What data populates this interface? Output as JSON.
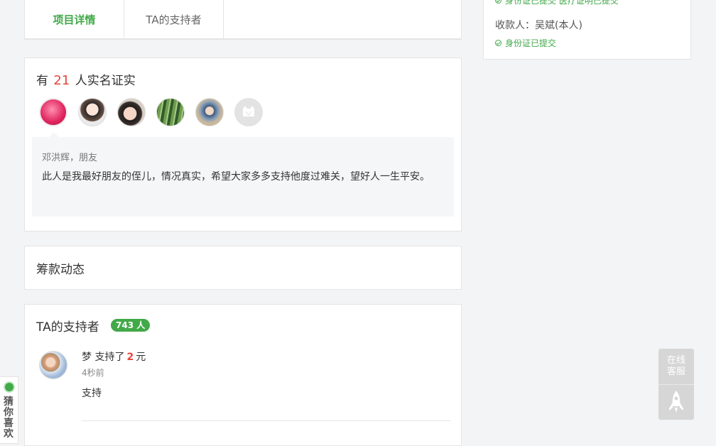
{
  "tabs": [
    {
      "label": "项目详情",
      "active": true
    },
    {
      "label": "TA的支持者",
      "active": false
    }
  ],
  "sidebar": {
    "payee_label": "收款人：",
    "payee_name": "吴斌(本人)",
    "id_status": "身份证已提交",
    "top_partial": "身份证已提交  医疗证明已提交"
  },
  "verify": {
    "title_prefix": "有",
    "count": "21",
    "title_suffix": "人实名证实",
    "avatars": [
      "avatar-flower",
      "avatar-girl",
      "avatar-child",
      "avatar-plants",
      "avatar-boy",
      "avatar-default"
    ],
    "quote": {
      "author": "邓洪辉，朋友",
      "text": "此人是我最好朋友的侄儿，情况真实，希望大家多多支持他度过难关，望好人一生平安。"
    }
  },
  "dynamics": {
    "title": "筹款动态"
  },
  "supporters": {
    "title": "TA的支持者",
    "badge": "743 人",
    "entries": [
      {
        "name": "梦",
        "action": "支持了",
        "amount": "2",
        "unit": "元",
        "time": "4秒前",
        "message": "支持"
      }
    ]
  },
  "float": {
    "service_label": "在线客服"
  },
  "guess": {
    "label": "猜你喜欢"
  },
  "colors": {
    "brand_green": "#42a949",
    "accent_red": "#e5463c",
    "page_bg": "#f3f4f5"
  }
}
